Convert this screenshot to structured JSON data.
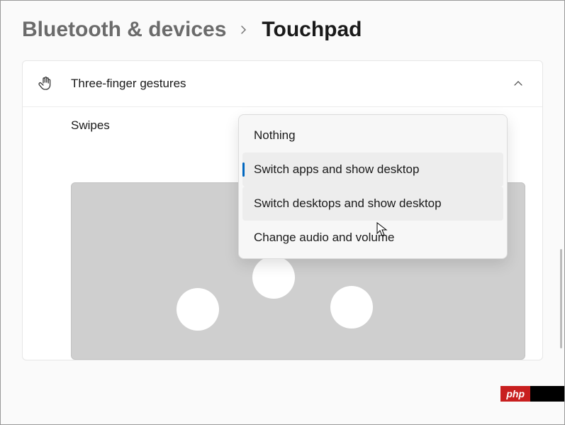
{
  "breadcrumb": {
    "parent": "Bluetooth & devices",
    "current": "Touchpad"
  },
  "section": {
    "title": "Three-finger gestures"
  },
  "swipes": {
    "label": "Swipes"
  },
  "dropdown": {
    "options": [
      {
        "label": "Nothing"
      },
      {
        "label": "Switch apps and show desktop"
      },
      {
        "label": "Switch desktops and show desktop"
      },
      {
        "label": "Change audio and volume"
      }
    ],
    "selectedIndex": 1,
    "hoverIndex": 2
  },
  "watermark": {
    "text": "php"
  }
}
